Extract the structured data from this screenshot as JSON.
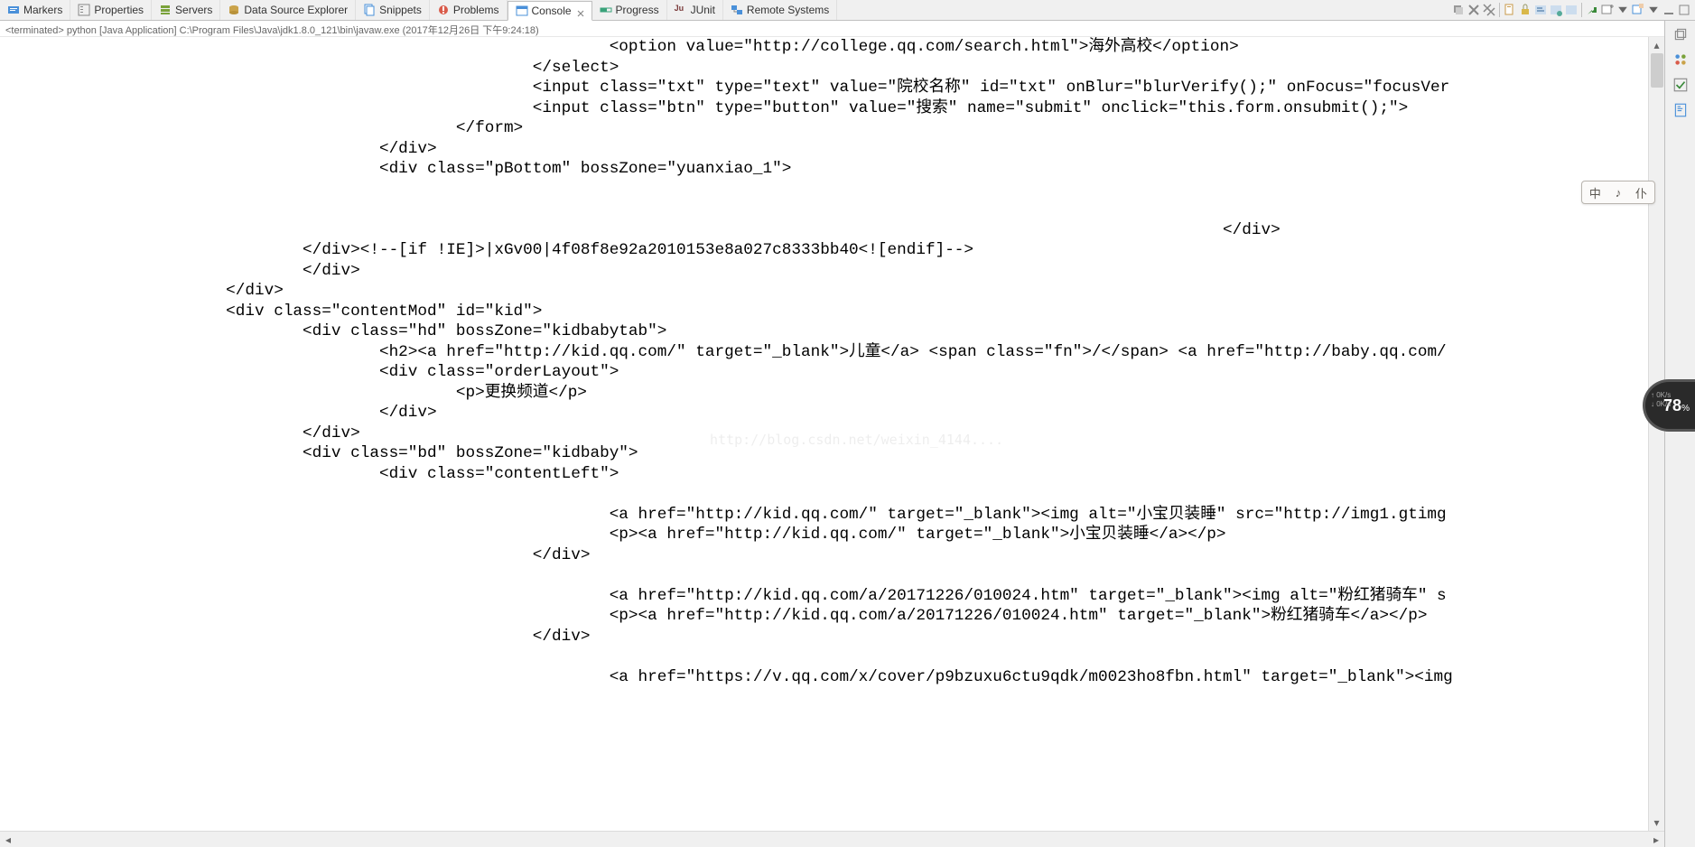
{
  "tabs": [
    {
      "label": "Markers",
      "icon": "markers"
    },
    {
      "label": "Properties",
      "icon": "properties"
    },
    {
      "label": "Servers",
      "icon": "servers"
    },
    {
      "label": "Data Source Explorer",
      "icon": "datasource"
    },
    {
      "label": "Snippets",
      "icon": "snippets"
    },
    {
      "label": "Problems",
      "icon": "problems"
    },
    {
      "label": "Console",
      "icon": "console",
      "active": true,
      "closable": true
    },
    {
      "label": "Progress",
      "icon": "progress"
    },
    {
      "label": "JUnit",
      "icon": "junit",
      "prefix": "Ju"
    },
    {
      "label": "Remote Systems",
      "icon": "remote"
    }
  ],
  "status_line": "<terminated> python [Java Application] C:\\Program Files\\Java\\jdk1.8.0_121\\bin\\javaw.exe (2017年12月26日 下午9:24:18)",
  "console_output": "                                                               <option value=\"http://college.qq.com/search.html\">海外高校</option>\n                                                       </select>\n                                                       <input class=\"txt\" type=\"text\" value=\"院校名称\" id=\"txt\" onBlur=\"blurVerify();\" onFocus=\"focusVer\n                                                       <input class=\"btn\" type=\"button\" value=\"搜索\" name=\"submit\" onclick=\"this.form.onsubmit();\">\n                                               </form>\n                                       </div>\n                                       <div class=\"pBottom\" bossZone=\"yuanxiao_1\">\n\n\n                                                                                                                               </div>\n                               </div><!--[if !IE]>|xGv00|4f08f8e92a2010153e8a027c8333bb40<![endif]-->\n                               </div>\n                       </div>\n                       <div class=\"contentMod\" id=\"kid\">\n                               <div class=\"hd\" bossZone=\"kidbabytab\">\n                                       <h2><a href=\"http://kid.qq.com/\" target=\"_blank\">儿童</a> <span class=\"fn\">/</span> <a href=\"http://baby.qq.com/\n                                       <div class=\"orderLayout\">\n                                               <p>更换频道</p>\n                                       </div>\n                               </div>\n                               <div class=\"bd\" bossZone=\"kidbaby\">\n                                       <div class=\"contentLeft\">\n\n                                                               <a href=\"http://kid.qq.com/\" target=\"_blank\"><img alt=\"小宝贝装睡\" src=\"http://img1.gtimg\n                                                               <p><a href=\"http://kid.qq.com/\" target=\"_blank\">小宝贝装睡</a></p>\n                                                       </div>\n\n                                                               <a href=\"http://kid.qq.com/a/20171226/010024.htm\" target=\"_blank\"><img alt=\"粉红猪骑车\" s\n                                                               <p><a href=\"http://kid.qq.com/a/20171226/010024.htm\" target=\"_blank\">粉红猪骑车</a></p>\n                                                       </div>\n\n                                                               <a href=\"https://v.qq.com/x/cover/p9bzuxu6ctu9qdk/m0023ho8fbn.html\" target=\"_blank\"><img",
  "ime": {
    "a": "中",
    "b": "♪",
    "c": "仆"
  },
  "net": {
    "up": "↑  0K/s",
    "down": "↓  0K/s",
    "pct": "78",
    "pct_suffix": "%"
  },
  "watermark": "http://blog.csdn.net/weixin_4144....",
  "icons": {
    "markers": "#4a90d9",
    "properties": "#888",
    "servers": "#7aa23a",
    "datasource": "#caa34a",
    "snippets": "#4a90d9",
    "problems": "#d95b4a",
    "console": "#4a90d9",
    "progress": "#3aa27a",
    "junit": "#7a3a3a",
    "remote": "#4a90d9"
  }
}
